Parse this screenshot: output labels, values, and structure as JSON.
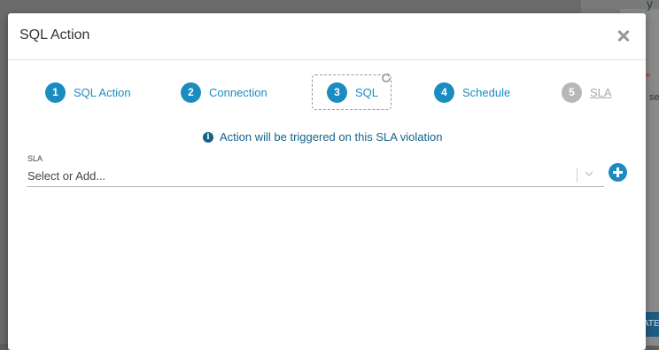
{
  "background": {
    "snippet_top": "y",
    "snippet_right": "se",
    "required_mark": "*",
    "button_fragment": "ATE"
  },
  "modal": {
    "title": "SQL Action",
    "close_icon": "close-icon"
  },
  "steps": [
    {
      "number": "1",
      "label": "SQL Action",
      "state": "complete"
    },
    {
      "number": "2",
      "label": "Connection",
      "state": "complete"
    },
    {
      "number": "3",
      "label": "SQL",
      "state": "active"
    },
    {
      "number": "4",
      "label": "Schedule",
      "state": "complete"
    },
    {
      "number": "5",
      "label": "SLA",
      "state": "disabled"
    }
  ],
  "info": {
    "icon": "info-icon",
    "text": "Action will be triggered on this SLA violation"
  },
  "sla_field": {
    "label": "SLA",
    "placeholder": "Select or Add...",
    "chevron_icon": "chevron-down-icon",
    "add_icon": "plus-circle-icon"
  },
  "colors": {
    "accent": "#1a8cc0",
    "info_text": "#14628a",
    "disabled": "#b7b7b7",
    "overlay": "#6b6b6b"
  }
}
